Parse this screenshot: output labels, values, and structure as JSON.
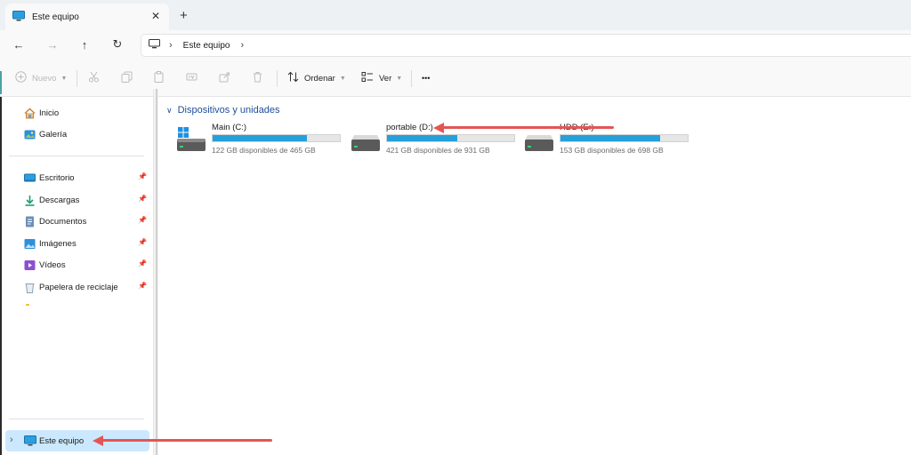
{
  "tab": {
    "title": "Este equipo",
    "close": "✕",
    "new_tab": "+"
  },
  "nav": {
    "back": "←",
    "forward": "→",
    "up": "↑",
    "refresh": "↻",
    "breadcrumb": "Este equipo",
    "chevron": "›"
  },
  "toolbar": {
    "new_label": "Nuevo",
    "sort_label": "Ordenar",
    "view_label": "Ver",
    "more": "•••"
  },
  "sidebar": {
    "items": [
      {
        "label": "Inicio",
        "icon": "home-icon",
        "pinned": false
      },
      {
        "label": "Galería",
        "icon": "gallery-icon",
        "pinned": false
      },
      {
        "label": "Escritorio",
        "icon": "desktop-icon",
        "pinned": true
      },
      {
        "label": "Descargas",
        "icon": "download-icon",
        "pinned": true
      },
      {
        "label": "Documentos",
        "icon": "document-icon",
        "pinned": true
      },
      {
        "label": "Imágenes",
        "icon": "image-icon",
        "pinned": true
      },
      {
        "label": "Vídeos",
        "icon": "video-icon",
        "pinned": true
      },
      {
        "label": "Papelera de reciclaje",
        "icon": "recycle-bin-icon",
        "pinned": true
      }
    ],
    "this_pc": {
      "label": "Este equipo",
      "expander": "›"
    }
  },
  "main": {
    "group_title": "Dispositivos y unidades",
    "drives": [
      {
        "name": "Main (C:)",
        "free": "122 GB disponibles de 465 GB",
        "used_fraction": 0.74,
        "system": true
      },
      {
        "name": "portable (D:)",
        "free": "421 GB disponibles de 931 GB",
        "used_fraction": 0.55,
        "system": false
      },
      {
        "name": "HDD (E:)",
        "free": "153 GB disponibles de 698 GB",
        "used_fraction": 0.78,
        "system": false
      }
    ]
  },
  "colors": {
    "accent": "#26a0da",
    "selection": "#cce8ff",
    "annotation_arrow": "#e45554",
    "group_title": "#1f4e9a"
  }
}
